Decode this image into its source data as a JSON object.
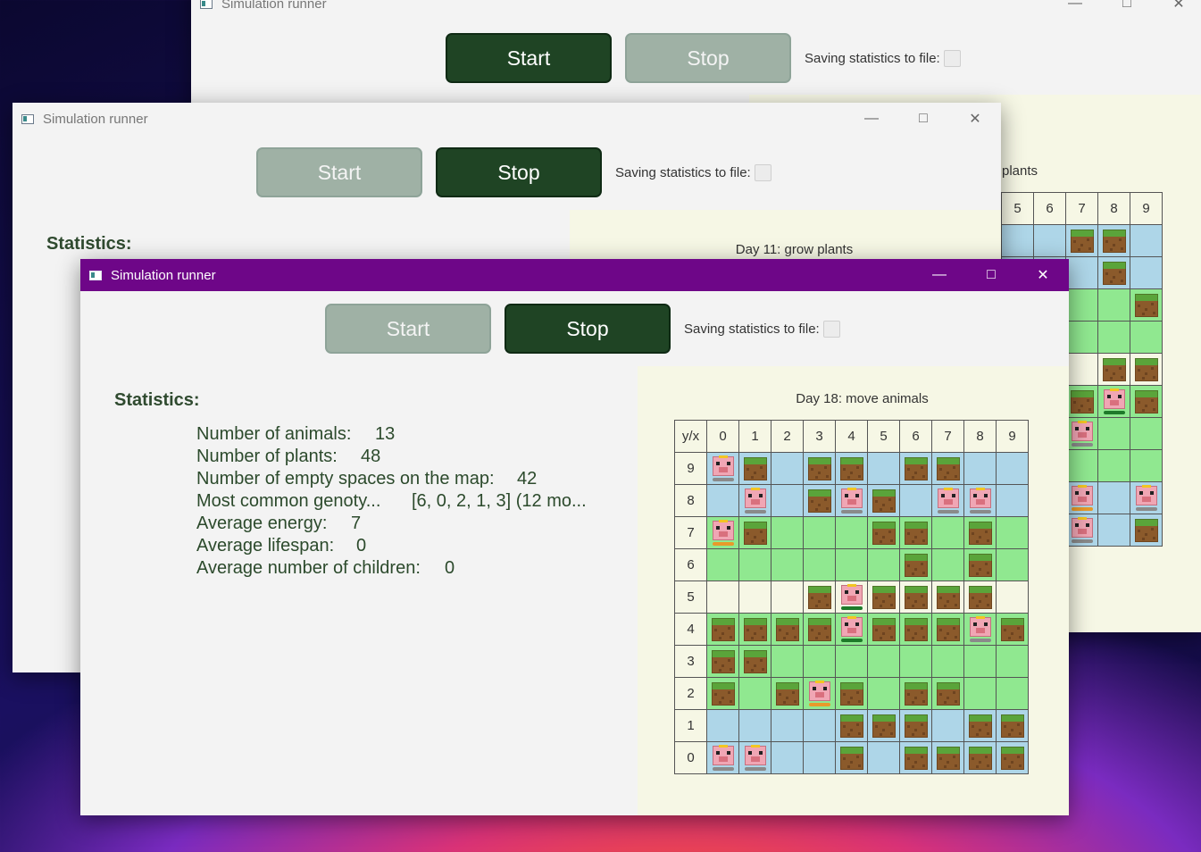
{
  "back_window": {
    "title": "Simulation runner",
    "start_label": "Start",
    "stop_label": "Stop",
    "saving_label": "Saving statistics to file:",
    "partial_day": "plants",
    "col_headers": [
      "5",
      "6",
      "7",
      "8",
      "9"
    ],
    "rows": [
      [
        "lt",
        "lt",
        "lt:plant",
        "lt:plant",
        "lt"
      ],
      [
        "lt",
        "lt",
        "lt",
        "lt:plant",
        "lt"
      ],
      [
        "gr",
        "gr",
        "gr",
        "gr",
        "gr:plant"
      ],
      [
        "gr",
        "gr",
        "gr",
        "gr",
        "gr"
      ],
      [
        "yw",
        "yw",
        "yw",
        "yw:plant",
        "yw:plant"
      ],
      [
        "gr",
        "gr",
        "gr:plant",
        "gr:pig:green",
        "gr:plant"
      ],
      [
        "gr",
        "gr",
        "gr:pig:gray",
        "gr",
        "gr"
      ],
      [
        "gr",
        "gr",
        "gr",
        "gr",
        "gr"
      ],
      [
        "lt",
        "lt",
        "lt:pig:orange",
        "lt",
        "lt:pig:gray"
      ],
      [
        "lt",
        "lt",
        "lt:pig:gray",
        "lt",
        "lt:plant"
      ]
    ]
  },
  "middle_window": {
    "title": "Simulation runner",
    "start_label": "Start",
    "stop_label": "Stop",
    "saving_label": "Saving statistics to file:",
    "stats_title": "Statistics:",
    "day_label": "Day 11: grow plants"
  },
  "front_window": {
    "title": "Simulation runner",
    "start_label": "Start",
    "stop_label": "Stop",
    "saving_label": "Saving statistics to file:",
    "stats_title": "Statistics:",
    "stats": [
      {
        "label": "Number of animals:",
        "value": "13"
      },
      {
        "label": "Number of plants:",
        "value": "48"
      },
      {
        "label": "Number of empty spaces on the map:",
        "value": "42"
      },
      {
        "label": "Most common genoty...",
        "value": "[6, 0, 2, 1, 3] (12 mo..."
      },
      {
        "label": "Average energy:",
        "value": "7"
      },
      {
        "label": "Average lifespan:",
        "value": "0"
      },
      {
        "label": "Average number of children:",
        "value": "0"
      }
    ],
    "day_label": "Day 18: move animals",
    "corner_label": "y/x",
    "col_headers": [
      "0",
      "1",
      "2",
      "3",
      "4",
      "5",
      "6",
      "7",
      "8",
      "9"
    ],
    "row_headers": [
      "9",
      "8",
      "7",
      "6",
      "5",
      "4",
      "3",
      "2",
      "1",
      "0"
    ],
    "rows": [
      [
        "lt:pig:gray",
        "lt:plant",
        "lt",
        "lt:plant",
        "lt:plant",
        "lt",
        "lt:plant",
        "lt:plant",
        "lt",
        "lt"
      ],
      [
        "lt",
        "lt:pig:gray",
        "lt",
        "lt:plant",
        "lt:pig:gray",
        "lt:plant",
        "lt",
        "lt:pig:gray",
        "lt:pig:gray",
        "lt"
      ],
      [
        "gr:pig:orange",
        "gr:plant",
        "gr",
        "gr",
        "gr",
        "gr:plant",
        "gr:plant",
        "gr",
        "gr:plant",
        "gr"
      ],
      [
        "gr",
        "gr",
        "gr",
        "gr",
        "gr",
        "gr",
        "gr:plant",
        "gr",
        "gr:plant",
        "gr"
      ],
      [
        "yw",
        "yw",
        "yw",
        "yw:plant",
        "yw:pig:green",
        "yw:plant",
        "yw:plant",
        "yw:plant",
        "yw:plant",
        "yw"
      ],
      [
        "gr:plant",
        "gr:plant",
        "gr:plant",
        "gr:plant",
        "gr:pig:green",
        "gr:plant",
        "gr:plant",
        "gr:plant",
        "gr:pig:gray",
        "gr:plant"
      ],
      [
        "gr:plant",
        "gr:plant",
        "gr",
        "gr",
        "gr",
        "gr",
        "gr",
        "gr",
        "gr",
        "gr"
      ],
      [
        "gr:plant",
        "gr",
        "gr:plant",
        "gr:pig:orange",
        "gr:plant",
        "gr",
        "gr:plant",
        "gr:plant",
        "gr",
        "gr"
      ],
      [
        "lt",
        "lt",
        "lt",
        "lt",
        "lt:plant",
        "lt:plant",
        "lt:plant",
        "lt",
        "lt:plant",
        "lt:plant"
      ],
      [
        "lt:pig:gray",
        "lt:pig:gray",
        "lt",
        "lt",
        "lt:plant",
        "lt",
        "lt:plant",
        "lt:plant",
        "lt:plant",
        "lt:plant"
      ]
    ]
  },
  "icons": {
    "minimize": "minimize-icon",
    "maximize": "maximize-icon",
    "close": "close-icon",
    "app": "app-icon"
  },
  "colors": {
    "button_active": "#1f4424",
    "button_disabled": "#9fb1a5",
    "active_titlebar": "#6e0688",
    "water": "#aed6e8",
    "grass": "#90e890",
    "equator": "#f6f7e5",
    "stat_text": "#2c4a2c"
  }
}
